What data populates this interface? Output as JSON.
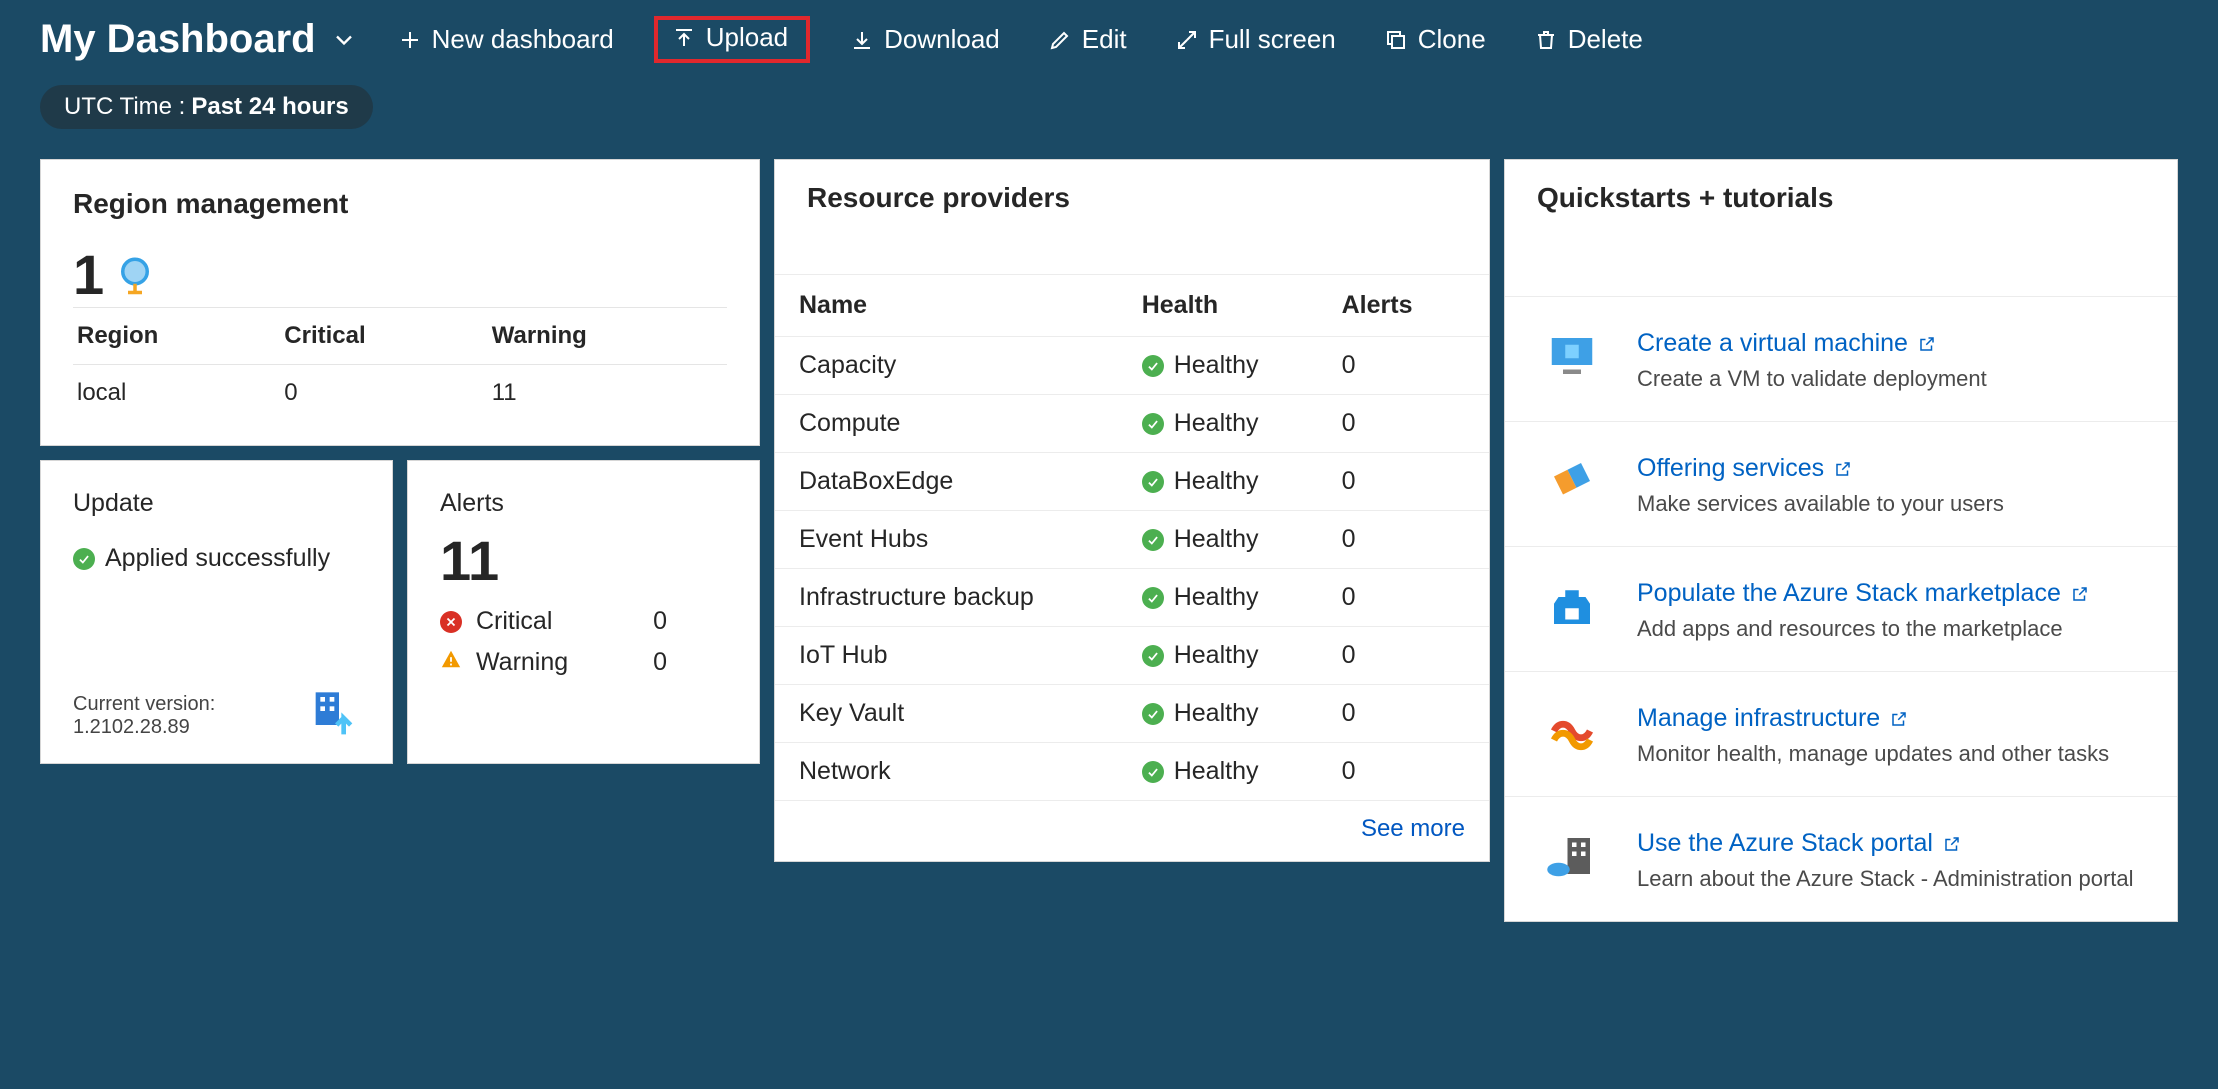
{
  "header": {
    "title": "My Dashboard",
    "buttons": {
      "new": "New dashboard",
      "upload": "Upload",
      "download": "Download",
      "edit": "Edit",
      "fullscreen": "Full screen",
      "clone": "Clone",
      "delete": "Delete"
    }
  },
  "time_filter": {
    "label": "UTC Time :",
    "value": "Past 24 hours"
  },
  "region_tile": {
    "title": "Region management",
    "count": "1",
    "columns": {
      "region": "Region",
      "critical": "Critical",
      "warning": "Warning"
    },
    "rows": [
      {
        "region": "local",
        "critical": "0",
        "warning": "11"
      }
    ]
  },
  "update_tile": {
    "title": "Update",
    "status": "Applied successfully",
    "current_version_label": "Current version:",
    "current_version": "1.2102.28.89"
  },
  "alerts_tile": {
    "title": "Alerts",
    "total": "11",
    "critical_label": "Critical",
    "critical_count": "0",
    "warning_label": "Warning",
    "warning_count": "0"
  },
  "resource_providers": {
    "title": "Resource providers",
    "columns": {
      "name": "Name",
      "health": "Health",
      "alerts": "Alerts"
    },
    "rows": [
      {
        "name": "Capacity",
        "health": "Healthy",
        "alerts": "0"
      },
      {
        "name": "Compute",
        "health": "Healthy",
        "alerts": "0"
      },
      {
        "name": "DataBoxEdge",
        "health": "Healthy",
        "alerts": "0"
      },
      {
        "name": "Event Hubs",
        "health": "Healthy",
        "alerts": "0"
      },
      {
        "name": "Infrastructure backup",
        "health": "Healthy",
        "alerts": "0"
      },
      {
        "name": "IoT Hub",
        "health": "Healthy",
        "alerts": "0"
      },
      {
        "name": "Key Vault",
        "health": "Healthy",
        "alerts": "0"
      },
      {
        "name": "Network",
        "health": "Healthy",
        "alerts": "0"
      }
    ],
    "see_more": "See more"
  },
  "quickstarts": {
    "title": "Quickstarts + tutorials",
    "items": [
      {
        "title": "Create a virtual machine",
        "desc": "Create a VM to validate deployment"
      },
      {
        "title": "Offering services",
        "desc": "Make services available to your users"
      },
      {
        "title": "Populate the Azure Stack marketplace",
        "desc": "Add apps and resources to the marketplace"
      },
      {
        "title": "Manage infrastructure",
        "desc": "Monitor health, manage updates and other tasks"
      },
      {
        "title": "Use the Azure Stack portal",
        "desc": "Learn about the Azure Stack - Administration portal"
      }
    ]
  }
}
